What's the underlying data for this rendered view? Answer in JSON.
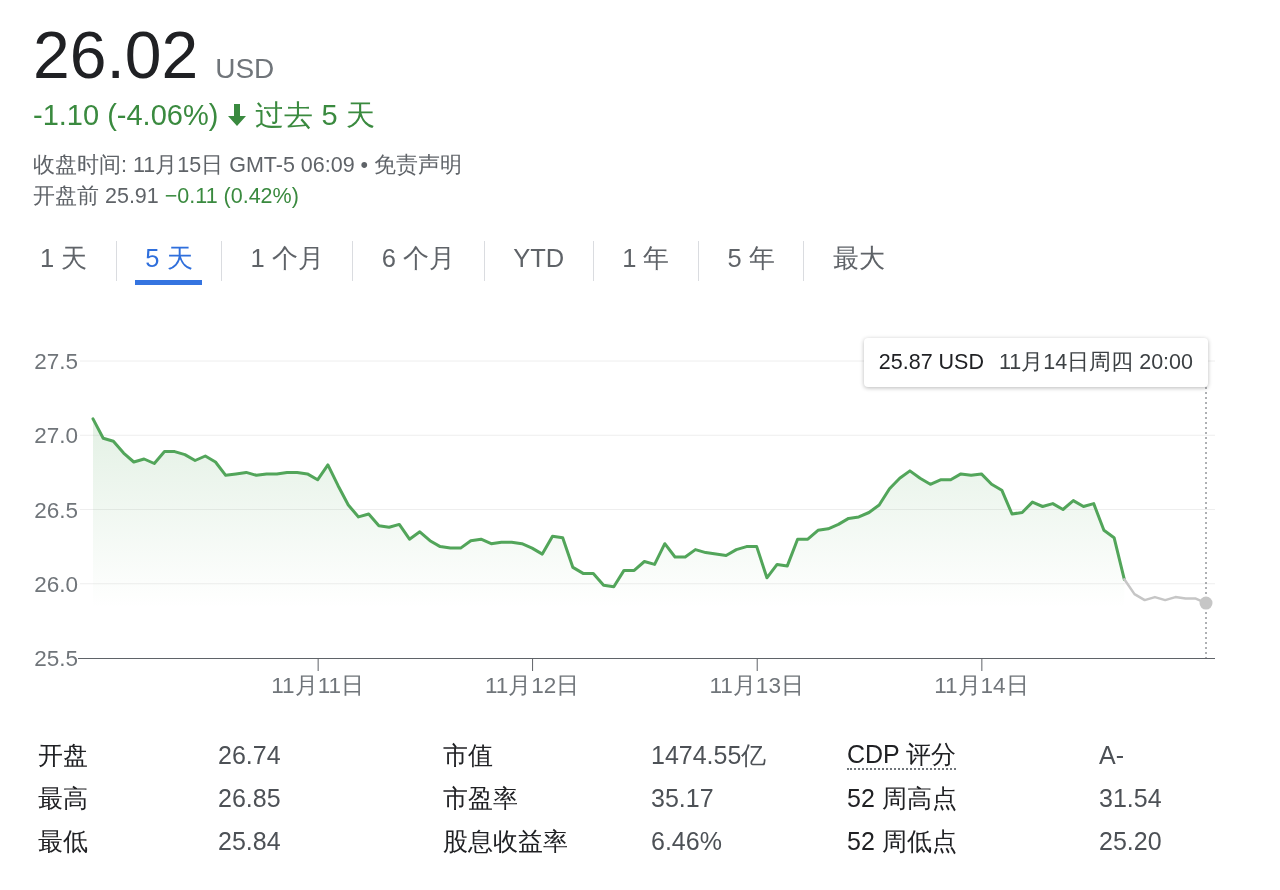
{
  "quote": {
    "price": "26.02",
    "currency": "USD",
    "change": "-1.10 (-4.06%)",
    "falling": true,
    "period": "过去 5 天",
    "close_time": "收盘时间: 11月15日 GMT-5 06:09 •",
    "disclaimer": "免责声明",
    "premarket_label": "开盘前 25.91",
    "premarket_change": "−0.11 (0.42%)"
  },
  "tabs": [
    {
      "label": "1 天",
      "selected": false
    },
    {
      "label": "5 天",
      "selected": true
    },
    {
      "label": "1 个月",
      "selected": false
    },
    {
      "label": "6 个月",
      "selected": false
    },
    {
      "label": "YTD",
      "selected": false
    },
    {
      "label": "1 年",
      "selected": false
    },
    {
      "label": "5 年",
      "selected": false
    },
    {
      "label": "最大",
      "selected": false
    }
  ],
  "chart": {
    "tooltip": {
      "price": "25.87 USD",
      "time": "11月14日周四 20:00"
    },
    "chart_data": {
      "type": "area",
      "grid": true,
      "categories": [
        null,
        null,
        null,
        null,
        null,
        null,
        null,
        null,
        null,
        null,
        null,
        null,
        null,
        null,
        null,
        null,
        null,
        null,
        null,
        null,
        null,
        null,
        "11月11日",
        null,
        null,
        null,
        null,
        null,
        null,
        null,
        null,
        null,
        null,
        null,
        null,
        null,
        null,
        null,
        null,
        null,
        null,
        null,
        null,
        "11月12日",
        null,
        null,
        null,
        null,
        null,
        null,
        null,
        null,
        null,
        null,
        null,
        null,
        null,
        null,
        null,
        null,
        null,
        null,
        null,
        null,
        null,
        "11月13日",
        null,
        null,
        null,
        null,
        null,
        null,
        null,
        null,
        null,
        null,
        null,
        null,
        null,
        null,
        null,
        null,
        null,
        null,
        null,
        null,
        null,
        "11月14日",
        null,
        null,
        null,
        null,
        null,
        null,
        null,
        null,
        null,
        null,
        null,
        null,
        null,
        null,
        null,
        null,
        null,
        null,
        null,
        null,
        null,
        null
      ],
      "ylim": [
        25.5,
        27.5
      ],
      "yticks": [
        {
          "value": 25.5,
          "label": "25.5"
        },
        {
          "value": 26,
          "label": "26.0"
        },
        {
          "value": 26.5,
          "label": "26.5"
        },
        {
          "value": 27,
          "label": "27.0"
        },
        {
          "value": 27.5,
          "label": "27.5"
        }
      ],
      "series": [
        {
          "type": "area",
          "color": "#52a55a",
          "values": [
            27.11,
            26.98,
            26.96,
            26.88,
            26.82,
            26.84,
            26.81,
            26.89,
            26.89,
            26.87,
            26.83,
            26.86,
            26.82,
            26.73,
            26.74,
            26.75,
            26.73,
            26.74,
            26.74,
            26.75,
            26.75,
            26.74,
            26.7,
            26.8,
            26.66,
            26.53,
            26.45,
            26.47,
            26.39,
            26.38,
            26.4,
            26.3,
            26.35,
            26.29,
            26.25,
            26.24,
            26.24,
            26.29,
            26.3,
            26.27,
            26.28,
            26.28,
            26.27,
            26.24,
            26.2,
            26.32,
            26.31,
            26.11,
            26.07,
            26.07,
            25.99,
            25.98,
            26.09,
            26.09,
            26.15,
            26.13,
            26.27,
            26.18,
            26.18,
            26.23,
            26.21,
            26.2,
            26.19,
            26.23,
            26.25,
            26.25,
            26.04,
            26.13,
            26.12,
            26.3,
            26.3,
            26.36,
            26.37,
            26.4,
            26.44,
            26.45,
            26.48,
            26.53,
            26.64,
            26.71,
            26.76,
            26.71,
            26.67,
            26.7,
            26.7,
            26.74,
            26.73,
            26.74,
            26.67,
            26.63,
            26.47,
            26.48,
            26.55,
            26.52,
            26.54,
            26.5,
            26.56,
            26.52,
            26.54,
            26.36,
            26.31,
            26.03,
            null,
            null,
            null,
            null,
            null,
            null,
            null,
            null
          ]
        },
        {
          "type": "line",
          "color": "#c6c6c6",
          "values": [
            null,
            null,
            null,
            null,
            null,
            null,
            null,
            null,
            null,
            null,
            null,
            null,
            null,
            null,
            null,
            null,
            null,
            null,
            null,
            null,
            null,
            null,
            null,
            null,
            null,
            null,
            null,
            null,
            null,
            null,
            null,
            null,
            null,
            null,
            null,
            null,
            null,
            null,
            null,
            null,
            null,
            null,
            null,
            null,
            null,
            null,
            null,
            null,
            null,
            null,
            null,
            null,
            null,
            null,
            null,
            null,
            null,
            null,
            null,
            null,
            null,
            null,
            null,
            null,
            null,
            null,
            null,
            null,
            null,
            null,
            null,
            null,
            null,
            null,
            null,
            null,
            null,
            null,
            null,
            null,
            null,
            null,
            null,
            null,
            null,
            null,
            null,
            null,
            null,
            null,
            null,
            null,
            null,
            null,
            null,
            null,
            null,
            null,
            null,
            null,
            null,
            26.03,
            25.93,
            25.89,
            25.91,
            25.89,
            25.91,
            25.9,
            25.9,
            25.87
          ]
        }
      ]
    }
  },
  "stats": [
    [
      {
        "label": "开盘",
        "value": "26.74",
        "info": false
      },
      {
        "label": "最高",
        "value": "26.85",
        "info": false
      },
      {
        "label": "最低",
        "value": "25.84",
        "info": false
      }
    ],
    [
      {
        "label": "市值",
        "value": "1474.55亿",
        "info": false
      },
      {
        "label": "市盈率",
        "value": "35.17",
        "info": false
      },
      {
        "label": "股息收益率",
        "value": "6.46%",
        "info": false
      }
    ],
    [
      {
        "label": "CDP 评分",
        "value": "A-",
        "info": true
      },
      {
        "label": "52 周高点",
        "value": "31.54",
        "info": false
      },
      {
        "label": "52 周低点",
        "value": "25.20",
        "info": false
      }
    ]
  ]
}
